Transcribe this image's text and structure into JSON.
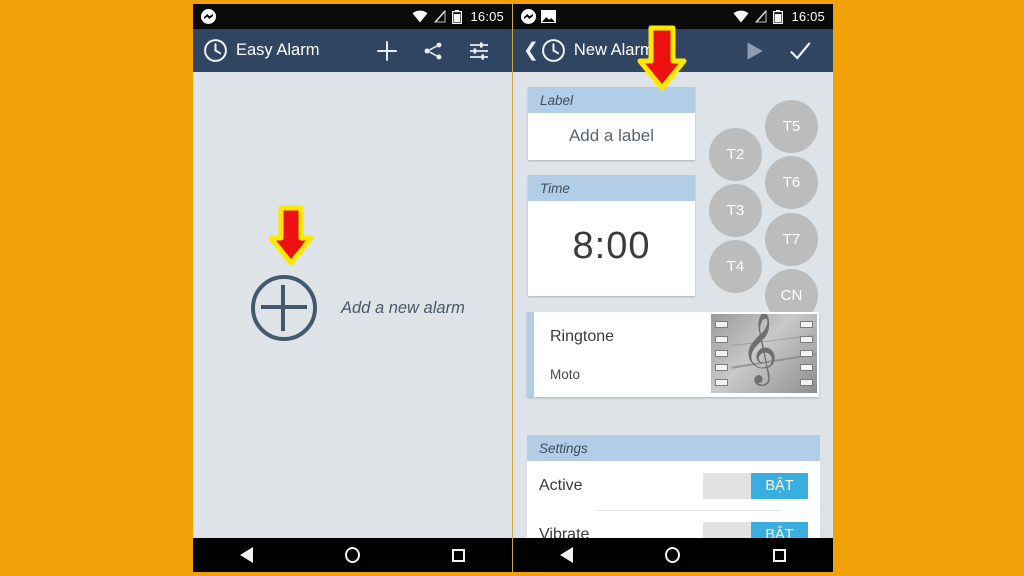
{
  "theme": {
    "page_background": "#F2A007",
    "toolbar_color": "#2f4561",
    "section_header_color": "#b2cde7",
    "accent_toggle_color": "#3aaede",
    "arrow_fill": "#ee1111",
    "arrow_outline": "#ffe800"
  },
  "left_phone": {
    "statusbar": {
      "notification_icons": [
        "messenger-icon"
      ],
      "system_icons": [
        "wifi-icon",
        "signal-off-icon",
        "battery-icon"
      ],
      "clock": "16:05"
    },
    "toolbar": {
      "app_icon": "clock-icon",
      "title": "Easy Alarm",
      "actions": [
        {
          "name": "add-alarm-button",
          "icon": "plus-icon"
        },
        {
          "name": "share-button",
          "icon": "share-icon"
        },
        {
          "name": "settings-button",
          "icon": "sliders-icon"
        }
      ]
    },
    "content": {
      "add_alarm_label": "Add a new alarm",
      "add_alarm_icon": "plus-circle-icon"
    },
    "navbar": [
      "back-icon",
      "home-icon",
      "recents-icon"
    ]
  },
  "right_phone": {
    "statusbar": {
      "notification_icons": [
        "messenger-icon",
        "screenshot-icon"
      ],
      "system_icons": [
        "wifi-icon",
        "signal-off-icon",
        "battery-icon"
      ],
      "clock": "16:05"
    },
    "toolbar": {
      "back_icon": "chevron-left-icon",
      "app_icon": "clock-icon",
      "title": "New Alarm",
      "actions": [
        {
          "name": "preview-button",
          "icon": "play-icon"
        },
        {
          "name": "confirm-button",
          "icon": "check-icon"
        }
      ]
    },
    "label_section": {
      "header": "Label",
      "placeholder": "Add a label",
      "value": "Add a label"
    },
    "time_section": {
      "header": "Time",
      "value": "8:00"
    },
    "days": [
      {
        "id": "t2",
        "label": "T2",
        "selected": false
      },
      {
        "id": "t3",
        "label": "T3",
        "selected": false
      },
      {
        "id": "t4",
        "label": "T4",
        "selected": false
      },
      {
        "id": "t5",
        "label": "T5",
        "selected": false
      },
      {
        "id": "t6",
        "label": "T6",
        "selected": false
      },
      {
        "id": "t7",
        "label": "T7",
        "selected": false
      },
      {
        "id": "cn",
        "label": "CN",
        "selected": false
      }
    ],
    "ringtone_section": {
      "title": "Ringtone",
      "value": "Moto",
      "thumbnail_icon": "music-note-filmstrip-icon"
    },
    "settings_section": {
      "header": "Settings",
      "rows": [
        {
          "name": "Active",
          "toggle_label": "BẬT"
        },
        {
          "name": "Vibrate",
          "toggle_label": "BẬT"
        }
      ]
    },
    "navbar": [
      "back-icon",
      "home-icon",
      "recents-icon"
    ]
  },
  "annotations": [
    {
      "name": "arrow-add-alarm",
      "points_to": "add-new-alarm-button",
      "direction": "down"
    },
    {
      "name": "arrow-new-alarm-toolbar",
      "points_to": "new-alarm-toolbar",
      "direction": "down"
    }
  ]
}
